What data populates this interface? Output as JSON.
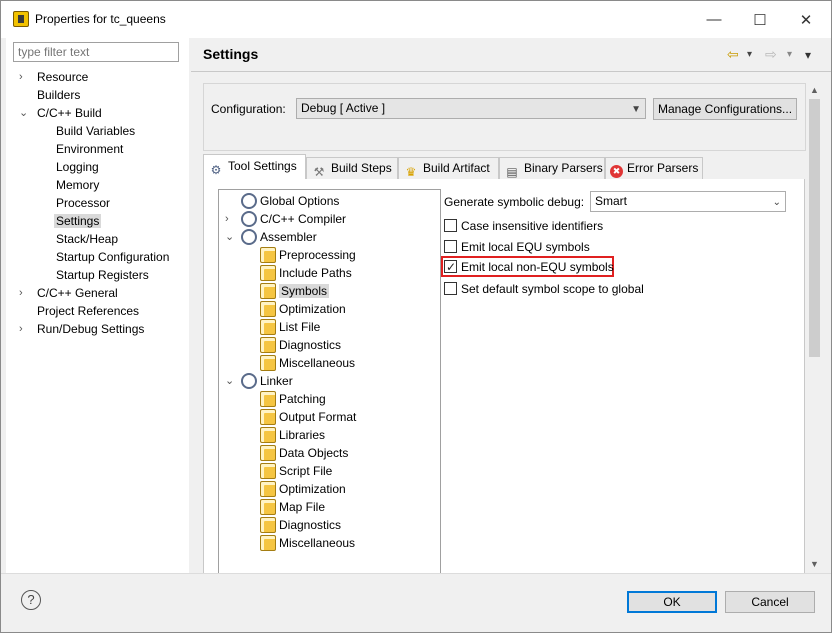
{
  "window": {
    "title": "Properties for tc_queens",
    "minimize_glyph": "—",
    "maximize_glyph": "☐",
    "close_glyph": "✕"
  },
  "filter": {
    "placeholder": "type filter text",
    "value": ""
  },
  "nav": [
    {
      "label": "Resource",
      "expander": "›"
    },
    {
      "label": "Builders",
      "expander": ""
    },
    {
      "label": "C/C++ Build",
      "expander": "⌄"
    },
    {
      "label": "Build Variables",
      "expander": ""
    },
    {
      "label": "Environment",
      "expander": ""
    },
    {
      "label": "Logging",
      "expander": ""
    },
    {
      "label": "Memory",
      "expander": ""
    },
    {
      "label": "Processor",
      "expander": ""
    },
    {
      "label": "Settings",
      "expander": "",
      "selected": true
    },
    {
      "label": "Stack/Heap",
      "expander": ""
    },
    {
      "label": "Startup Configuration",
      "expander": ""
    },
    {
      "label": "Startup Registers",
      "expander": ""
    },
    {
      "label": "C/C++ General",
      "expander": "›"
    },
    {
      "label": "Project References",
      "expander": ""
    },
    {
      "label": "Run/Debug Settings",
      "expander": "›"
    }
  ],
  "header": {
    "title": "Settings",
    "back_glyph": "⇦",
    "forward_glyph": "⇨",
    "dropdown_glyph": "▾",
    "menu_glyph": "▾"
  },
  "configuration": {
    "label": "Configuration:",
    "value": "Debug  [ Active ]",
    "manage_label": "Manage Configurations..."
  },
  "tabs": [
    {
      "label": "Tool Settings",
      "icon": "tool-settings-icon",
      "glyph": "⚙",
      "active": true
    },
    {
      "label": "Build Steps",
      "icon": "build-steps-icon",
      "glyph": "🔨"
    },
    {
      "label": "Build Artifact",
      "icon": "build-artifact-icon",
      "glyph": "🏆"
    },
    {
      "label": "Binary Parsers",
      "icon": "binary-parsers-icon",
      "glyph": "▤"
    },
    {
      "label": "Error Parsers",
      "icon": "error-parsers-icon",
      "glyph": "✖"
    }
  ],
  "tool_tree": [
    {
      "label": "Global Options",
      "icon": "gear",
      "expander": ""
    },
    {
      "label": "C/C++ Compiler",
      "icon": "gear",
      "expander": "›"
    },
    {
      "label": "Assembler",
      "icon": "gear",
      "expander": "⌄"
    },
    {
      "label": "Preprocessing",
      "icon": "folder",
      "expander": ""
    },
    {
      "label": "Include Paths",
      "icon": "folder",
      "expander": ""
    },
    {
      "label": "Symbols",
      "icon": "folder",
      "expander": "",
      "selected": true
    },
    {
      "label": "Optimization",
      "icon": "folder",
      "expander": ""
    },
    {
      "label": "List File",
      "icon": "folder",
      "expander": ""
    },
    {
      "label": "Diagnostics",
      "icon": "folder",
      "expander": ""
    },
    {
      "label": "Miscellaneous",
      "icon": "folder",
      "expander": ""
    },
    {
      "label": "Linker",
      "icon": "gear",
      "expander": "⌄"
    },
    {
      "label": "Patching",
      "icon": "folder",
      "expander": ""
    },
    {
      "label": "Output Format",
      "icon": "folder",
      "expander": ""
    },
    {
      "label": "Libraries",
      "icon": "folder",
      "expander": ""
    },
    {
      "label": "Data Objects",
      "icon": "folder",
      "expander": ""
    },
    {
      "label": "Script File",
      "icon": "folder",
      "expander": ""
    },
    {
      "label": "Optimization",
      "icon": "folder",
      "expander": ""
    },
    {
      "label": "Map File",
      "icon": "folder",
      "expander": ""
    },
    {
      "label": "Diagnostics",
      "icon": "folder",
      "expander": ""
    },
    {
      "label": "Miscellaneous",
      "icon": "folder",
      "expander": ""
    }
  ],
  "options": {
    "symbolic_debug_label": "Generate symbolic debug:",
    "symbolic_debug_value": "Smart",
    "checkboxes": [
      {
        "label": "Case insensitive identifiers",
        "checked": false
      },
      {
        "label": "Emit local EQU symbols",
        "checked": false
      },
      {
        "label": "Emit local non-EQU symbols",
        "checked": true,
        "highlighted": true
      },
      {
        "label": "Set default symbol scope to global",
        "checked": false
      }
    ],
    "highlight_color": "#e02020"
  },
  "footer": {
    "help_glyph": "?",
    "ok_label": "OK",
    "cancel_label": "Cancel"
  },
  "colors": {
    "accent": "#0078d7",
    "selection": "#d9d9d9"
  }
}
